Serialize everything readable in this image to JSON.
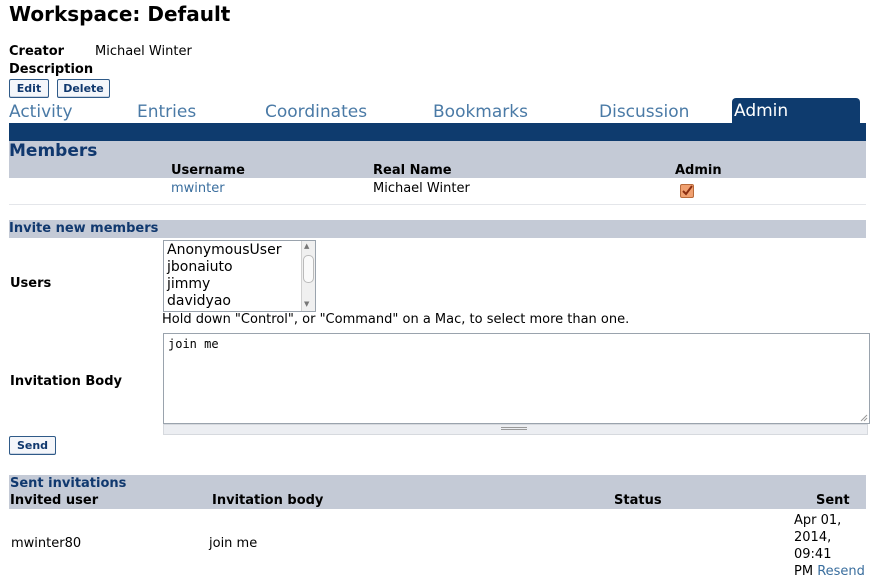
{
  "page": {
    "title": "Workspace: Default",
    "creator_label": "Creator",
    "creator_value": "Michael Winter",
    "description_label": "Description",
    "edit_label": "Edit",
    "delete_label": "Delete"
  },
  "tabs": [
    {
      "label": "Activity"
    },
    {
      "label": "Entries"
    },
    {
      "label": "Coordinates"
    },
    {
      "label": "Bookmarks"
    },
    {
      "label": "Discussion"
    },
    {
      "label": "Admin"
    }
  ],
  "members": {
    "heading": "Members",
    "columns": [
      "Username",
      "Real Name",
      "Admin"
    ],
    "rows": [
      {
        "username": "mwinter",
        "real_name": "Michael Winter",
        "admin": true
      }
    ]
  },
  "invite": {
    "heading": "Invite new members",
    "users_label": "Users",
    "users_options": [
      "AnonymousUser",
      "jbonaiuto",
      "jimmy",
      "davidyao"
    ],
    "help_text": "Hold down \"Control\", or \"Command\" on a Mac, to select more than one.",
    "body_label": "Invitation Body",
    "body_value": "join me",
    "send_label": "Send"
  },
  "sent": {
    "heading": "Sent invitations",
    "columns": [
      "Invited user",
      "Invitation body",
      "Status",
      "Sent"
    ],
    "rows": [
      {
        "user": "mwinter80",
        "body": "join me",
        "status": "",
        "sent_line1": "Apr 01,",
        "sent_line2": "2014,",
        "sent_line3": "09:41",
        "sent_line4": "PM",
        "resend": "Resend"
      }
    ]
  },
  "colors": {
    "accent": "#0e3b6e",
    "section_bg": "#c4cad6",
    "link": "#3a6e9e"
  }
}
